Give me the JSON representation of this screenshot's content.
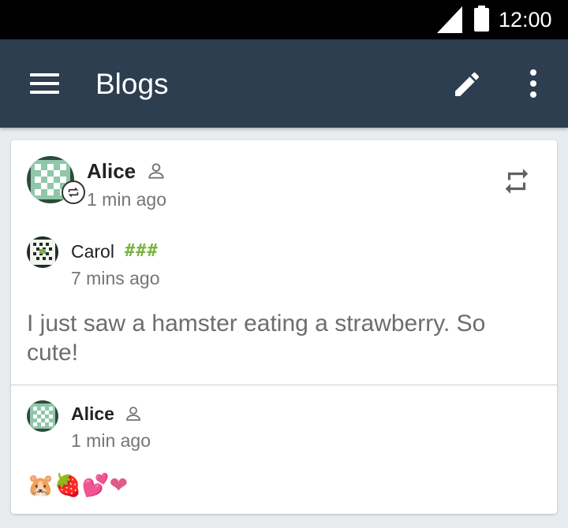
{
  "status_bar": {
    "time": "12:00",
    "icons": [
      "cell-signal-icon",
      "battery-icon"
    ]
  },
  "app_bar": {
    "title": "Blogs",
    "icons": [
      "menu-icon",
      "edit-icon",
      "more-vertical-icon"
    ]
  },
  "repost": {
    "reposter": {
      "name": "Alice",
      "time": "1 min ago",
      "icon": "person-icon"
    },
    "action_icon": "repost-icon",
    "original": {
      "author": {
        "name": "Carol",
        "tag": "###",
        "time": "7 mins ago"
      },
      "text": "I just saw a hamster eating a strawberry. So cute!"
    }
  },
  "comment": {
    "author": {
      "name": "Alice",
      "time": "1 min ago",
      "icon": "person-icon"
    },
    "emojis": [
      "🐹",
      "🍓",
      "💕",
      "❤"
    ]
  },
  "colors": {
    "app_bar": "#2c3e50",
    "status_bar": "#000000",
    "background": "#e8ecef",
    "tag": "#7cb342"
  }
}
